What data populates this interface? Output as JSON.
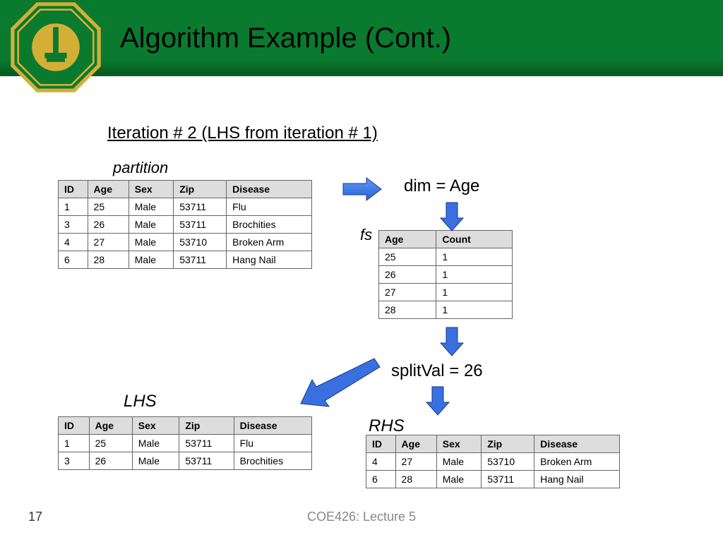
{
  "title": "Algorithm Example (Cont.)",
  "subtitle": "Iteration # 2 (LHS from iteration # 1)",
  "labels": {
    "partition": "partition",
    "dim": "dim = Age",
    "fs": "fs",
    "split": "splitVal = 26",
    "lhs": "LHS",
    "rhs": "RHS"
  },
  "partition": {
    "headers": [
      "ID",
      "Age",
      "Sex",
      "Zip",
      "Disease"
    ],
    "rows": [
      [
        "1",
        "25",
        "Male",
        "53711",
        "Flu"
      ],
      [
        "3",
        "26",
        "Male",
        "53711",
        "Brochities"
      ],
      [
        "4",
        "27",
        "Male",
        "53710",
        "Broken Arm"
      ],
      [
        "6",
        "28",
        "Male",
        "53711",
        "Hang Nail"
      ]
    ]
  },
  "fs": {
    "headers": [
      "Age",
      "Count"
    ],
    "rows": [
      [
        "25",
        "1"
      ],
      [
        "26",
        "1"
      ],
      [
        "27",
        "1"
      ],
      [
        "28",
        "1"
      ]
    ]
  },
  "lhs": {
    "headers": [
      "ID",
      "Age",
      "Sex",
      "Zip",
      "Disease"
    ],
    "rows": [
      [
        "1",
        "25",
        "Male",
        "53711",
        "Flu"
      ],
      [
        "3",
        "26",
        "Male",
        "53711",
        "Brochities"
      ]
    ]
  },
  "rhs": {
    "headers": [
      "ID",
      "Age",
      "Sex",
      "Zip",
      "Disease"
    ],
    "rows": [
      [
        "4",
        "27",
        "Male",
        "53710",
        "Broken Arm"
      ],
      [
        "6",
        "28",
        "Male",
        "53711",
        "Hang Nail"
      ]
    ]
  },
  "footer": {
    "page": "17",
    "course": "COE426: Lecture 5"
  }
}
